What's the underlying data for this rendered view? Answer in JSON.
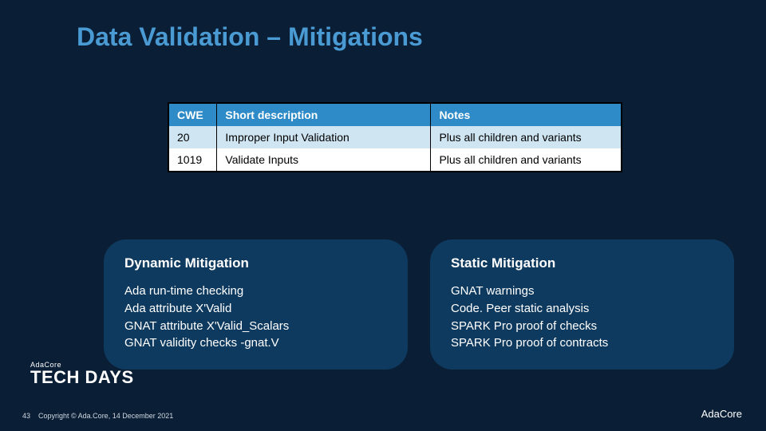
{
  "title": "Data Validation – Mitigations",
  "table": {
    "headers": {
      "cwe": "CWE",
      "desc": "Short description",
      "notes": "Notes"
    },
    "rows": [
      {
        "cwe": "20",
        "desc": "Improper Input Validation",
        "notes": "Plus all children and variants"
      },
      {
        "cwe": "1019",
        "desc": "Validate Inputs",
        "notes": "Plus all children and variants"
      }
    ]
  },
  "cards": {
    "dynamic": {
      "title": "Dynamic Mitigation",
      "lines": [
        "Ada run-time checking",
        "Ada attribute X'Valid",
        "GNAT attribute X'Valid_Scalars",
        "GNAT validity checks -gnat.V"
      ]
    },
    "static": {
      "title": "Static Mitigation",
      "lines": [
        "GNAT warnings",
        "Code. Peer static analysis",
        "SPARK Pro proof of checks",
        "SPARK Pro proof of contracts"
      ]
    }
  },
  "footer": {
    "page": "43",
    "copyright": "Copyright © Ada.Core, 14 December 2021"
  },
  "brand": {
    "small": "AdaCore",
    "big1": "TECH",
    "big2": "DAYS",
    "right": "AdaCore"
  }
}
